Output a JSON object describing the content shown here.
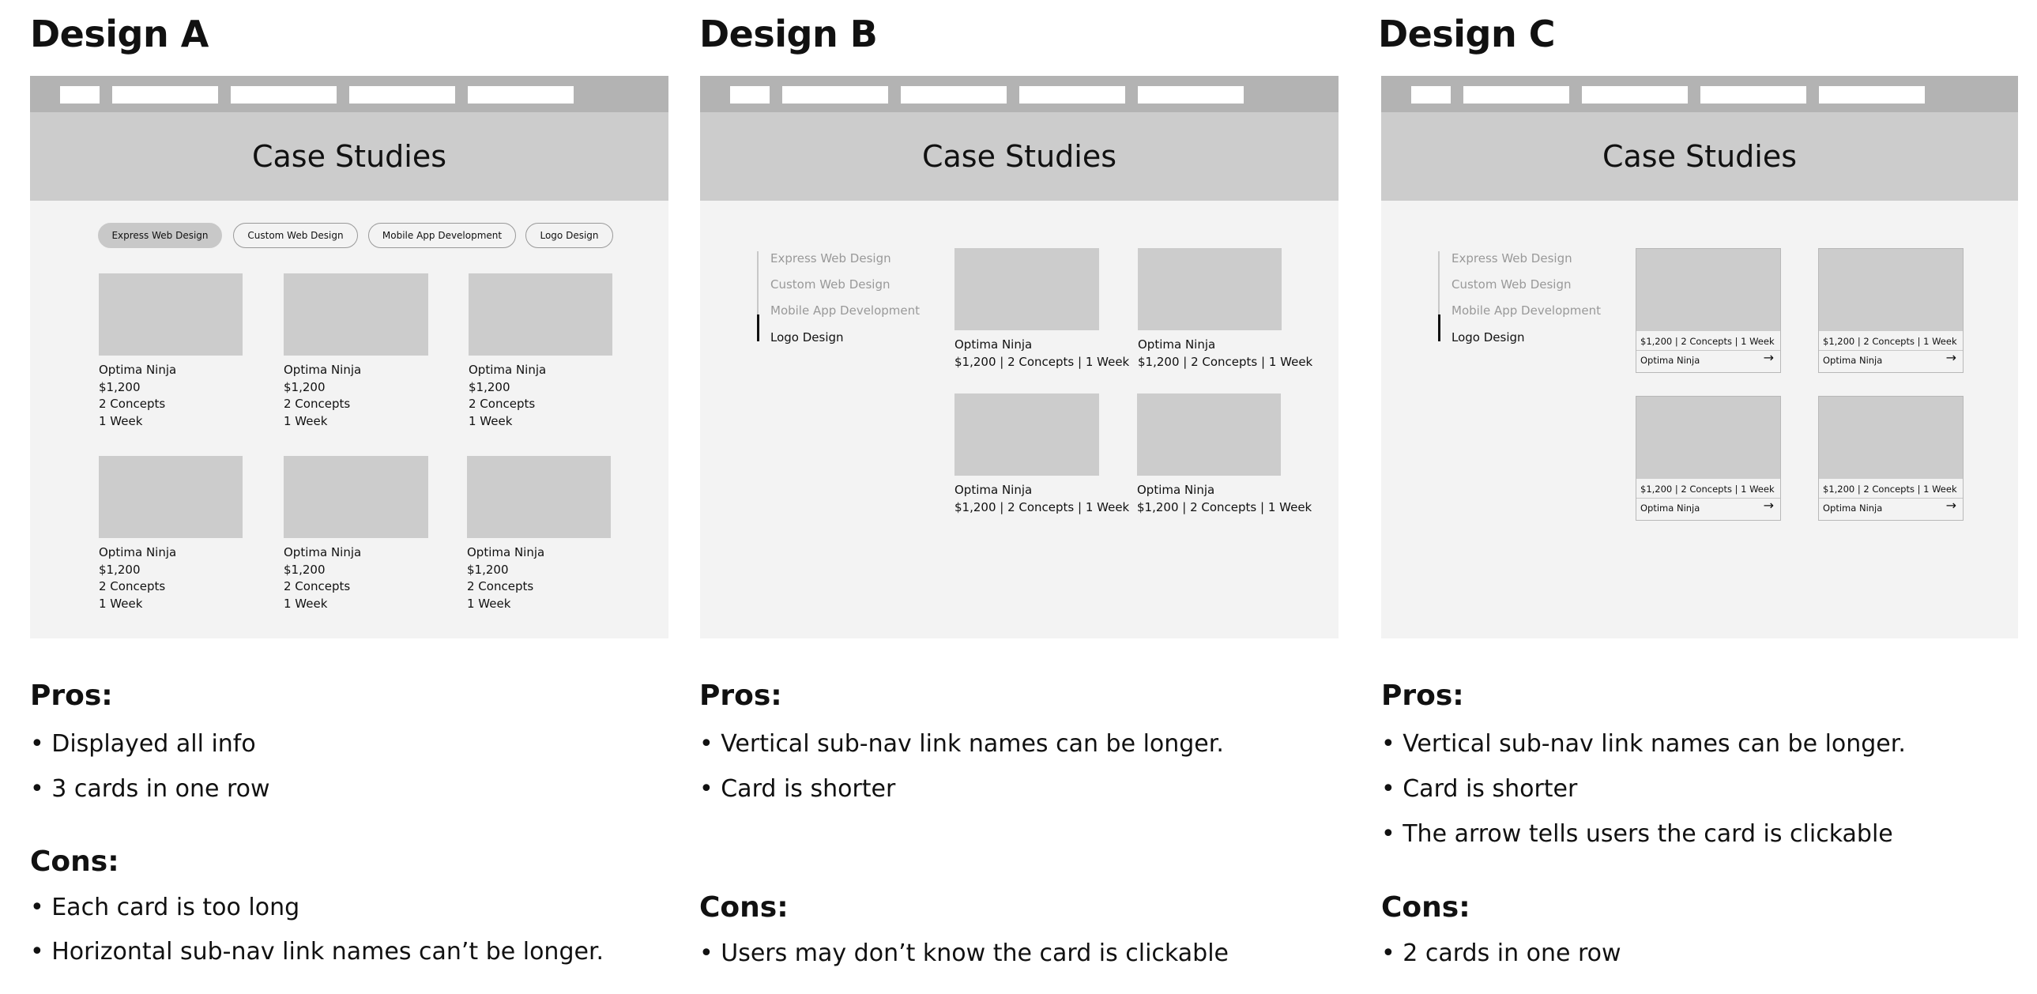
{
  "designs": [
    {
      "title": "Design A",
      "hero_title": "Case Studies",
      "tabs": [
        "Express Web Design",
        "Custom Web Design",
        "Mobile App Development",
        "Logo Design"
      ],
      "card": {
        "name": "Optima Ninja",
        "price": "$1,200",
        "concepts": "2 Concepts",
        "duration": "1 Week"
      },
      "pros_heading": "Pros:",
      "pros": [
        "• Displayed all info",
        "• 3 cards in one row"
      ],
      "cons_heading": "Cons:",
      "cons": [
        "• Each card is too long",
        "• Horizontal sub-nav link names can’t be longer."
      ]
    },
    {
      "title": "Design B",
      "hero_title": "Case Studies",
      "subnav": [
        "Express Web Design",
        "Custom Web Design",
        "Mobile App Development",
        "Logo Design"
      ],
      "card": {
        "name": "Optima Ninja",
        "meta": "$1,200 | 2 Concepts | 1 Week"
      },
      "pros_heading": "Pros:",
      "pros": [
        "• Vertical sub-nav link names can be longer.",
        "• Card is shorter"
      ],
      "cons_heading": "Cons:",
      "cons": [
        "• Users may don’t know the card is clickable"
      ]
    },
    {
      "title": "Design C",
      "hero_title": "Case Studies",
      "subnav": [
        "Express Web Design",
        "Custom Web Design",
        "Mobile App Development",
        "Logo Design"
      ],
      "card": {
        "name": "Optima Ninja",
        "meta": "$1,200  |  2 Concepts | 1 Week",
        "arrow": "→"
      },
      "pros_heading": "Pros:",
      "pros": [
        "• Vertical sub-nav link names can be longer.",
        "• Card is shorter",
        "• The arrow tells users the card is clickable"
      ],
      "cons_heading": "Cons:",
      "cons": [
        "• 2 cards in one row"
      ]
    }
  ],
  "colors": {
    "topbar": "#b3b3b3",
    "hero": "#cccccc",
    "canvas": "#f3f3f3",
    "placeholder": "#cccccc",
    "active_tab": "#c8c8c8",
    "muted_text": "#999999"
  }
}
